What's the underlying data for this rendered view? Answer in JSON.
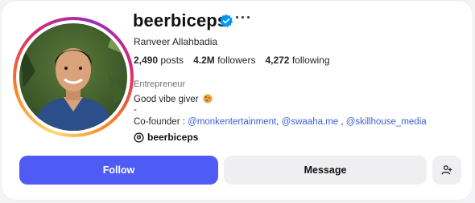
{
  "profile": {
    "username": "beerbiceps",
    "full_name": "Ranveer Allahbadia",
    "verified": true,
    "more_icon": "more-horizontal-icon",
    "stats": {
      "posts_count": "2,490",
      "posts_label": "posts",
      "followers_count": "4.2M",
      "followers_label": "followers",
      "following_count": "4,272",
      "following_label": "following"
    },
    "category": "Entrepreneur",
    "bio": {
      "line1": "Good vibe giver",
      "line2": "-",
      "cofounder_prefix": "Co-founder :",
      "mentions": [
        "@monkentertainment",
        "@swaaha.me",
        "@skillhouse_media"
      ],
      "separator1": ",",
      "separator2": " ,"
    },
    "threads_handle": "beerbiceps"
  },
  "actions": {
    "follow_label": "Follow",
    "message_label": "Message",
    "suggest_icon": "add-person-icon"
  },
  "colors": {
    "accent": "#4f5bf5",
    "link": "#3b5fd6",
    "verified": "#0095f6",
    "secondary_button": "#efeff1"
  }
}
